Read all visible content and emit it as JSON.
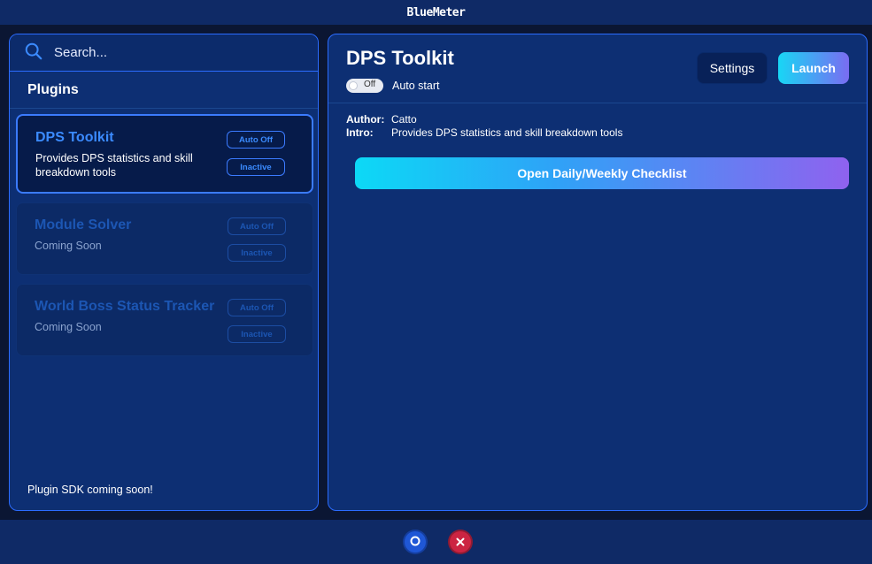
{
  "app": {
    "logo_text": "BlueMeter"
  },
  "sidebar": {
    "search": {
      "placeholder": "Search..."
    },
    "header": "Plugins",
    "plugins": [
      {
        "name": "DPS Toolkit",
        "description": "Provides DPS statistics and skill breakdown tools",
        "auto_label": "Auto Off",
        "status_label": "Inactive",
        "selected": true,
        "enabled": true
      },
      {
        "name": "Module Solver",
        "description": "Coming Soon",
        "auto_label": "Auto Off",
        "status_label": "Inactive",
        "selected": false,
        "enabled": false
      },
      {
        "name": "World Boss Status Tracker",
        "description": "Coming Soon",
        "auto_label": "Auto Off",
        "status_label": "Inactive",
        "selected": false,
        "enabled": false
      }
    ],
    "footer_note": "Plugin SDK coming soon!"
  },
  "detail": {
    "title": "DPS Toolkit",
    "toggle": {
      "state_label": "Off",
      "label": "Auto start",
      "on": false
    },
    "settings_label": "Settings",
    "launch_label": "Launch",
    "author_key": "Author:",
    "author_value": "Catto",
    "intro_key": "Intro:",
    "intro_value": "Provides DPS statistics and skill breakdown tools",
    "checklist_label": "Open Daily/Weekly Checklist"
  },
  "colors": {
    "accent": "#3b8bff",
    "launch_gradient_start": "#18d6f5",
    "launch_gradient_end": "#7a6cf2",
    "close_red": "#cc2442"
  }
}
